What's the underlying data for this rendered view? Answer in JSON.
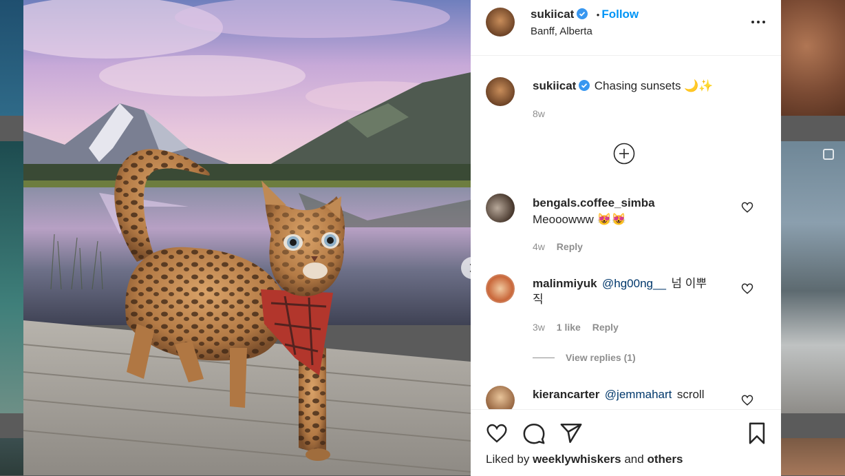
{
  "post": {
    "username": "sukiicat",
    "follow_label": "Follow",
    "separator": "•",
    "location": "Banff, Alberta",
    "caption_text": "Chasing sunsets 🌙✨",
    "caption_age": "8w",
    "load_more_icon": "plus-circle-icon",
    "next_icon": "chevron-right-icon"
  },
  "comments": [
    {
      "username": "bengals.coffee_simba",
      "text": "Meooowww 😻😻",
      "mention": "",
      "age": "4w",
      "likes": "",
      "reply_label": "Reply"
    },
    {
      "username": "malinmiyuk",
      "mention": "@hg00ng__",
      "text": "넘 이뿌",
      "text_line2": "직",
      "age": "3w",
      "likes": "1 like",
      "reply_label": "Reply",
      "view_replies": "View replies (1)"
    },
    {
      "username": "kierancarter",
      "mention": "@jemmahart",
      "text": "scroll",
      "age": "",
      "likes": "",
      "reply_label": ""
    }
  ],
  "actions": {
    "icons": [
      "heart-icon",
      "comment-icon",
      "share-icon",
      "bookmark-icon"
    ],
    "liked_prefix": "Liked by",
    "liked_user": "weeklywhiskers",
    "liked_and": "and",
    "liked_others": "others"
  },
  "colors": {
    "accent": "#0095f6",
    "mention": "#00376b",
    "muted": "#8e8e8e",
    "verified": "#3897f0"
  }
}
